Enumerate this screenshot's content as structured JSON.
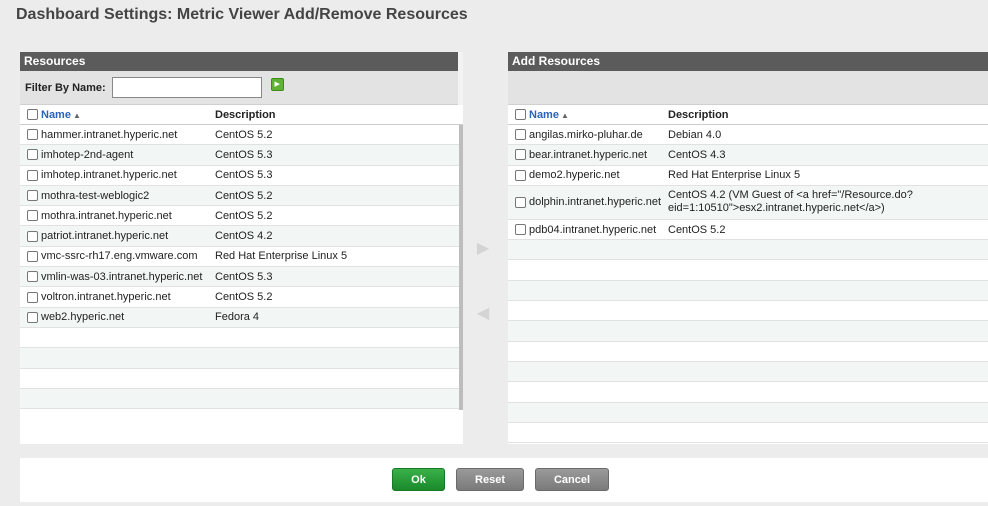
{
  "title": "Dashboard Settings: Metric Viewer Add/Remove Resources",
  "left_panel": {
    "header": "Resources",
    "filter_label": "Filter By Name:",
    "filter_value": "",
    "columns": {
      "name": "Name",
      "sort_arrow": "▲",
      "description": "Description"
    },
    "rows": [
      {
        "name": "hammer.intranet.hyperic.net",
        "description": "CentOS 5.2"
      },
      {
        "name": "imhotep-2nd-agent",
        "description": "CentOS 5.3"
      },
      {
        "name": "imhotep.intranet.hyperic.net",
        "description": "CentOS 5.3"
      },
      {
        "name": "mothra-test-weblogic2",
        "description": "CentOS 5.2"
      },
      {
        "name": "mothra.intranet.hyperic.net",
        "description": "CentOS 5.2"
      },
      {
        "name": "patriot.intranet.hyperic.net",
        "description": "CentOS 4.2"
      },
      {
        "name": "vmc-ssrc-rh17.eng.vmware.com",
        "description": "Red Hat Enterprise Linux 5"
      },
      {
        "name": "vmlin-was-03.intranet.hyperic.net",
        "description": "CentOS 5.3"
      },
      {
        "name": "voltron.intranet.hyperic.net",
        "description": "CentOS 5.2"
      },
      {
        "name": "web2.hyperic.net",
        "description": "Fedora 4"
      }
    ]
  },
  "right_panel": {
    "header": "Add Resources",
    "columns": {
      "name": "Name",
      "sort_arrow": "▲",
      "description": "Description"
    },
    "rows": [
      {
        "name": "angilas.mirko-pluhar.de",
        "description": "Debian 4.0"
      },
      {
        "name": "bear.intranet.hyperic.net",
        "description": "CentOS 4.3"
      },
      {
        "name": "demo2.hyperic.net",
        "description": "Red Hat Enterprise Linux 5"
      },
      {
        "name": "dolphin.intranet.hyperic.net",
        "description": "CentOS 4.2 (VM Guest of <a href=\"/Resource.do?eid=1:10510\">esx2.intranet.hyperic.net</a>)"
      },
      {
        "name": "pdb04.intranet.hyperic.net",
        "description": "CentOS 5.2"
      }
    ]
  },
  "transfer": {
    "add_icon": "right-arrow-icon",
    "remove_icon": "left-arrow-icon"
  },
  "buttons": {
    "ok": "Ok",
    "reset": "Reset",
    "cancel": "Cancel"
  },
  "colors": {
    "header_bg": "#5b5b5b",
    "ok_green": "#1f9a33",
    "link_blue": "#2a63b8"
  }
}
